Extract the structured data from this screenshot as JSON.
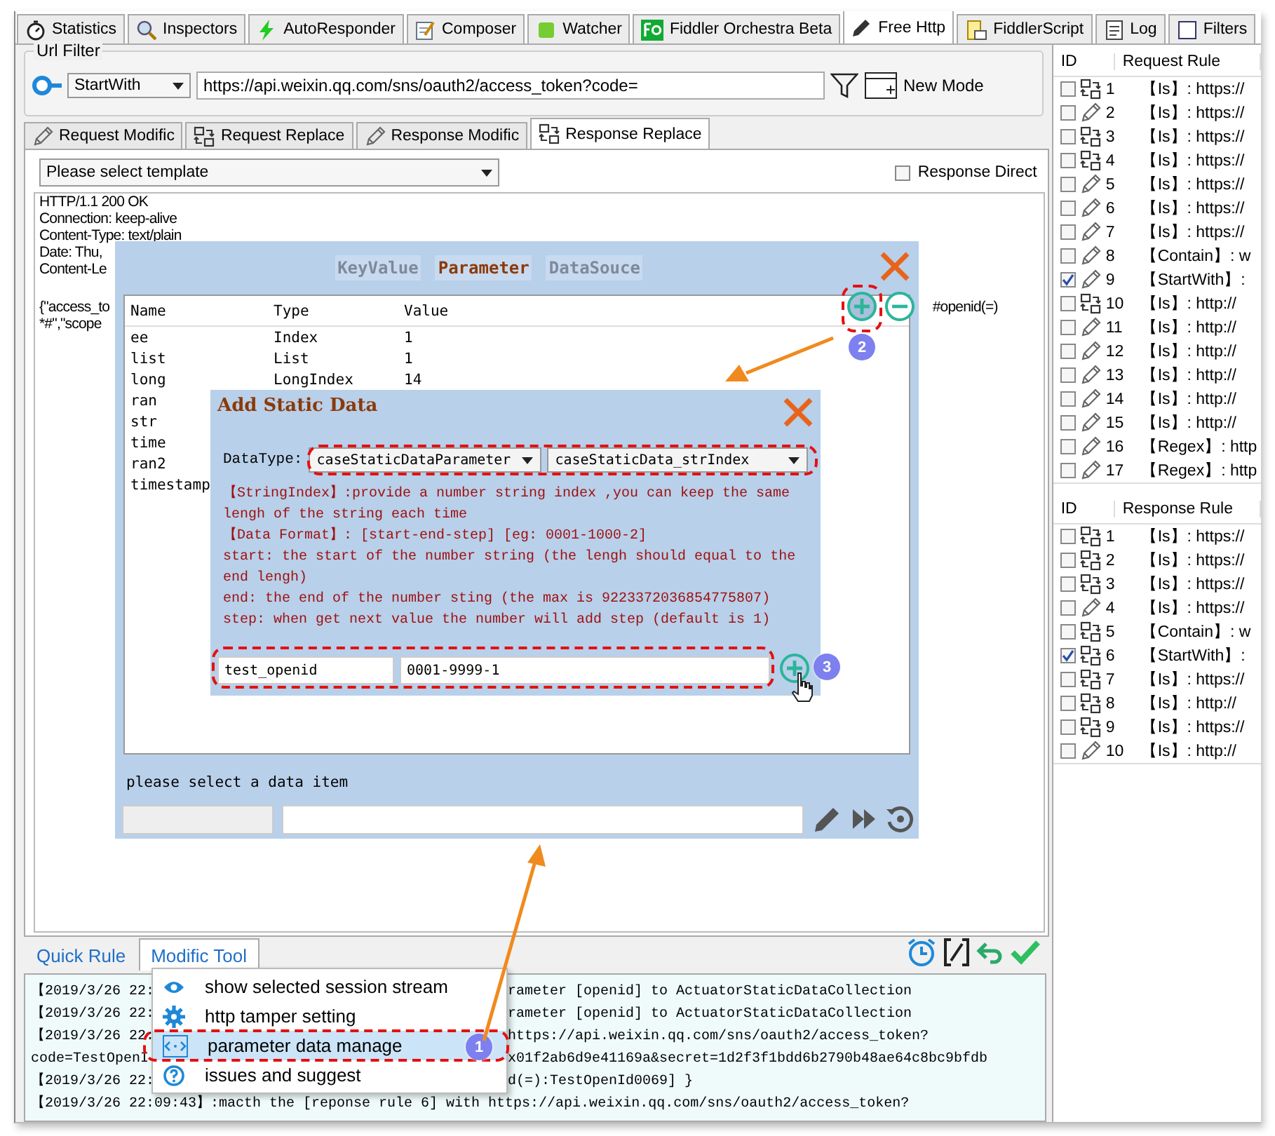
{
  "top_tabs": [
    {
      "label": "Statistics",
      "selected": false
    },
    {
      "label": "Inspectors",
      "selected": false
    },
    {
      "label": "AutoResponder",
      "selected": false
    },
    {
      "label": "Composer",
      "selected": false
    },
    {
      "label": "Watcher",
      "selected": false
    },
    {
      "label": "Fiddler Orchestra Beta",
      "selected": false
    },
    {
      "label": "Free Http",
      "selected": true
    },
    {
      "label": "FiddlerScript",
      "selected": false
    },
    {
      "label": "Log",
      "selected": false
    },
    {
      "label": "Filters",
      "selected": false
    }
  ],
  "url_filter": {
    "label": "Url Filter",
    "match_mode": "StartWith",
    "url": "https://api.weixin.qq.com/sns/oauth2/access_token?code=",
    "new_mode_button": "New Mode"
  },
  "rule_tabs": [
    {
      "label": "Request Modific",
      "kind": "modify",
      "selected": false
    },
    {
      "label": "Request Replace",
      "kind": "replace",
      "selected": false
    },
    {
      "label": "Response Modific",
      "kind": "modify",
      "selected": false
    },
    {
      "label": "Response Replace",
      "kind": "replace",
      "selected": true
    }
  ],
  "template_select": "Please select template",
  "response_direct": {
    "label": "Response Direct",
    "checked": false
  },
  "response_headers": [
    "HTTP/1.1 200 OK",
    "Connection: keep-alive",
    "Content-Type: text/plain",
    "Date: Thu,",
    "Content-Le"
  ],
  "response_body": [
    "{\"access_to",
    "*#\",\"scope"
  ],
  "response_body_right": "#openid(=)",
  "parameter_dialog": {
    "tabs": [
      {
        "label": "KeyValue",
        "selected": false
      },
      {
        "label": "Parameter",
        "selected": true
      },
      {
        "label": "DataSouce",
        "selected": false
      }
    ],
    "columns": [
      "Name",
      "Type",
      "Value"
    ],
    "rows": [
      {
        "name": "ee",
        "type": "Index",
        "value": "1"
      },
      {
        "name": "list",
        "type": "List",
        "value": "1"
      },
      {
        "name": "long",
        "type": "LongIndex",
        "value": "14"
      },
      {
        "name": "ran"
      },
      {
        "name": "str"
      },
      {
        "name": "time"
      },
      {
        "name": "ran2"
      },
      {
        "name": "timestamp"
      }
    ],
    "badge": "2",
    "status": "please select a data item"
  },
  "add_static_data": {
    "title": "Add Static Data",
    "datatype_label": "DataType:",
    "selects": [
      "caseStaticDataParameter",
      "caseStaticData_strIndex"
    ],
    "description": [
      "【StringIndex】:provide a number string index ,you can keep the same lengh of the string each time",
      "【Data Format】: [start-end-step] [eg: 0001-1000-2]",
      "start: the start of the number string (the lengh should equal to the end lengh)",
      "end: the end of the number sting (the max is 9223372036854775807)",
      "step: when get next value the number will add step (default is 1)"
    ],
    "name_value": "test_openid",
    "format_value": "0001-9999-1",
    "badge": "3"
  },
  "bottom_tabs": [
    {
      "label": "Quick Rule",
      "selected": false
    },
    {
      "label": "Modific Tool",
      "selected": true
    }
  ],
  "tool_menu": {
    "items": [
      {
        "label": "show selected session stream",
        "selected": false
      },
      {
        "label": "http tamper setting",
        "selected": false
      },
      {
        "label": "parameter data manage",
        "selected": true
      },
      {
        "label": "issues and suggest",
        "selected": false
      }
    ],
    "badge": "1"
  },
  "log_lines": [
    {
      "left": "【2019/3/26 22:",
      "right": "rameter [openid] to ActuatorStaticDataCollection"
    },
    {
      "left": "【2019/3/26 22:",
      "right": "rameter [openid] to ActuatorStaticDataCollection"
    },
    {
      "left": "【2019/3/26 22:",
      "right": "https://api.weixin.qq.com/sns/oauth2/access_token?"
    },
    {
      "left": "code=TestOpenI",
      "right": "x01f2ab6d9e41169a&secret=1d2f3f1bdd6b2790b48ae64c8bc9bfdb"
    },
    {
      "left": "【2019/3/26 22:",
      "right": "d(=):TestOpenId0069] }"
    },
    {
      "left": "【2019/3/26 22:09:43】:macth the [reponse rule 6] with https://api.weixin.qq.com/sns/oauth2/access_token?"
    }
  ],
  "request_rules": {
    "columns": [
      "ID",
      "Request Rule"
    ],
    "rows": [
      {
        "id": "1",
        "kind": "replace",
        "checked": false,
        "rule": "【Is】: https://"
      },
      {
        "id": "2",
        "kind": "modify",
        "checked": false,
        "rule": "【Is】: https://"
      },
      {
        "id": "3",
        "kind": "replace",
        "checked": false,
        "rule": "【Is】: https://"
      },
      {
        "id": "4",
        "kind": "replace",
        "checked": false,
        "rule": "【Is】: https://"
      },
      {
        "id": "5",
        "kind": "modify",
        "checked": false,
        "rule": "【Is】: https://"
      },
      {
        "id": "6",
        "kind": "modify",
        "checked": false,
        "rule": "【Is】: https://"
      },
      {
        "id": "7",
        "kind": "modify",
        "checked": false,
        "rule": "【Is】: https://"
      },
      {
        "id": "8",
        "kind": "modify",
        "checked": false,
        "rule": "【Contain】: w"
      },
      {
        "id": "9",
        "kind": "modify",
        "checked": true,
        "rule": "【StartWith】:"
      },
      {
        "id": "10",
        "kind": "replace",
        "checked": false,
        "rule": "【Is】: http://"
      },
      {
        "id": "11",
        "kind": "modify",
        "checked": false,
        "rule": "【Is】: http://"
      },
      {
        "id": "12",
        "kind": "modify",
        "checked": false,
        "rule": "【Is】: http://"
      },
      {
        "id": "13",
        "kind": "modify",
        "checked": false,
        "rule": "【Is】: http://"
      },
      {
        "id": "14",
        "kind": "modify",
        "checked": false,
        "rule": "【Is】: http://"
      },
      {
        "id": "15",
        "kind": "modify",
        "checked": false,
        "rule": "【Is】: http://"
      },
      {
        "id": "16",
        "kind": "modify",
        "checked": false,
        "rule": "【Regex】: http"
      },
      {
        "id": "17",
        "kind": "modify",
        "checked": false,
        "rule": "【Regex】: http"
      }
    ]
  },
  "response_rules": {
    "columns": [
      "ID",
      "Response Rule"
    ],
    "rows": [
      {
        "id": "1",
        "kind": "replace",
        "checked": false,
        "rule": "【Is】: https://"
      },
      {
        "id": "2",
        "kind": "replace",
        "checked": false,
        "rule": "【Is】: https://"
      },
      {
        "id": "3",
        "kind": "replace",
        "checked": false,
        "rule": "【Is】: https://"
      },
      {
        "id": "4",
        "kind": "modify",
        "checked": false,
        "rule": "【Is】: https://"
      },
      {
        "id": "5",
        "kind": "replace",
        "checked": false,
        "rule": "【Contain】: w"
      },
      {
        "id": "6",
        "kind": "replace",
        "checked": true,
        "rule": "【StartWith】:"
      },
      {
        "id": "7",
        "kind": "replace",
        "checked": false,
        "rule": "【Is】: https://"
      },
      {
        "id": "8",
        "kind": "replace",
        "checked": false,
        "rule": "【Is】: http://"
      },
      {
        "id": "9",
        "kind": "replace",
        "checked": false,
        "rule": "【Is】: https://"
      },
      {
        "id": "10",
        "kind": "modify",
        "checked": false,
        "rule": "【Is】: http://"
      }
    ]
  }
}
